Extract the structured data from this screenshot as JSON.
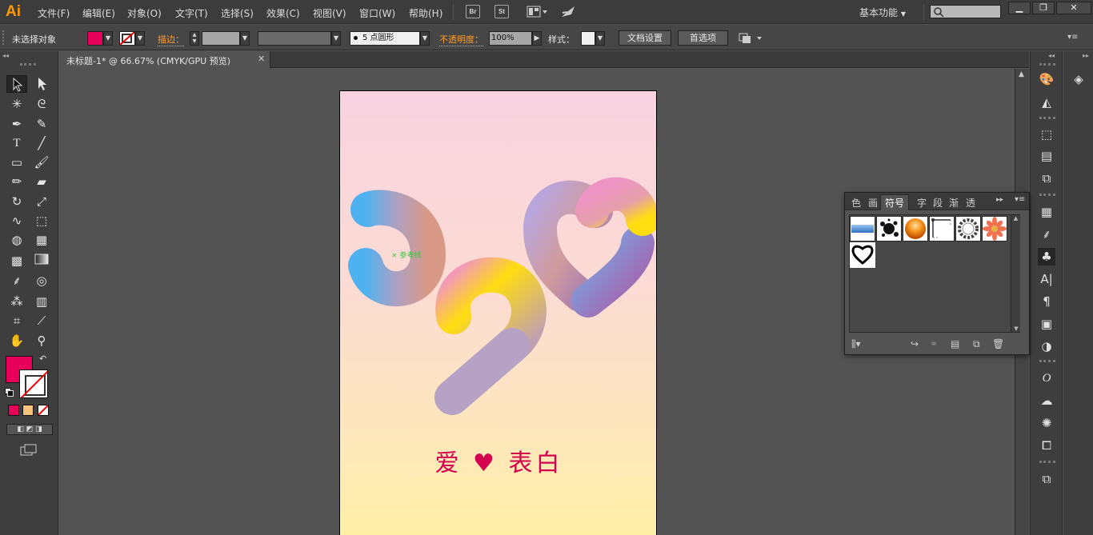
{
  "app": {
    "logo": "Ai",
    "workspace": "基本功能"
  },
  "menu": [
    "文件(F)",
    "编辑(E)",
    "对象(O)",
    "文字(T)",
    "选择(S)",
    "效果(C)",
    "视图(V)",
    "窗口(W)",
    "帮助(H)"
  ],
  "menubar_buttons": {
    "br": "Br",
    "st": "St"
  },
  "window_controls": {
    "minimize": "▁",
    "restore": "❐",
    "close": "✕"
  },
  "control_bar": {
    "selection_status": "未选择对象",
    "stroke_label": "描边：",
    "brush_label": "5 点圆形",
    "opacity_label": "不透明度：",
    "opacity_value": "100%",
    "style_label": "样式：",
    "doc_settings": "文档设置",
    "preferences": "首选项"
  },
  "document": {
    "tab_title": "未标题-1* @ 66.67% (CMYK/GPU 预览)",
    "close": "✕"
  },
  "artwork": {
    "caption": "爱 ♥ 表白",
    "smart_guide": "参考线"
  },
  "colors": {
    "fill": "#e6005a",
    "accent": "#ff9e2c",
    "caption": "#d4004f"
  },
  "symbol_panel": {
    "tabs": [
      "色",
      "画",
      "符号",
      "字",
      "段",
      "渐",
      "透"
    ],
    "active_tab": "符号",
    "symbols": [
      "blue-banner",
      "ink-splat",
      "orange-orb",
      "frame-corner",
      "wreath",
      "flower",
      "heart-outline"
    ]
  },
  "tools": [
    "selection",
    "direct-selection",
    "magic-wand",
    "lasso",
    "pen",
    "curvature",
    "type",
    "line",
    "rectangle",
    "paintbrush",
    "pencil",
    "eraser",
    "rotate",
    "scale",
    "warp",
    "free-transform",
    "shape-builder",
    "perspective",
    "mesh",
    "gradient",
    "eyedropper",
    "blend",
    "symbol-sprayer",
    "column-graph",
    "artboard",
    "slice",
    "hand",
    "zoom"
  ]
}
